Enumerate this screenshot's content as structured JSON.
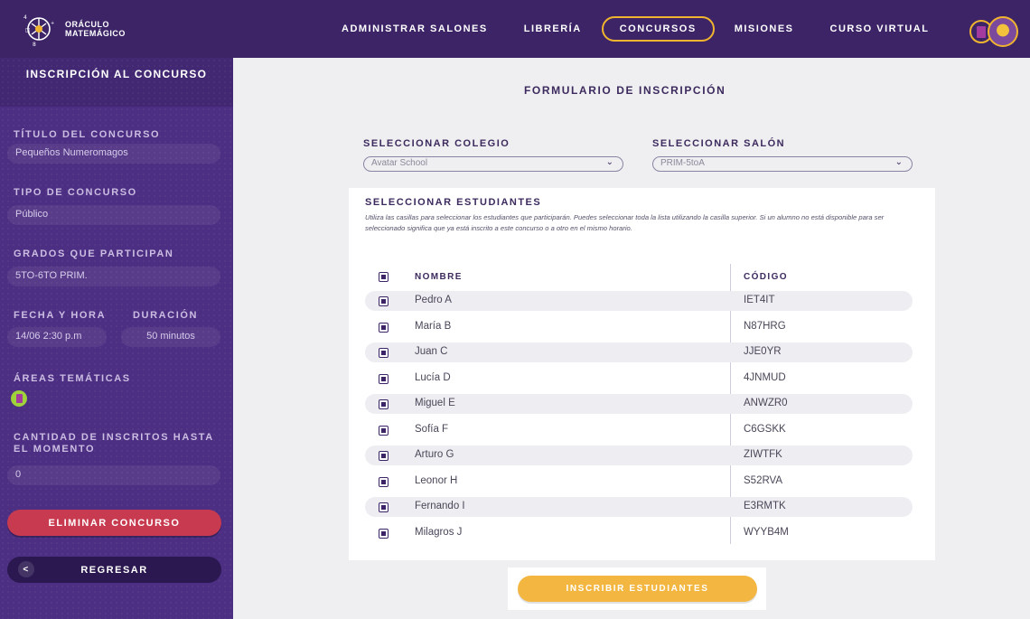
{
  "brand": {
    "line1": "ORÁCULO",
    "line2": "MATEMÁGICO"
  },
  "nav": {
    "items": [
      {
        "label": "ADMINISTRAR SALONES"
      },
      {
        "label": "LIBRERÍA"
      },
      {
        "label": "CONCURSOS"
      },
      {
        "label": "MISIONES"
      },
      {
        "label": "CURSO VIRTUAL"
      }
    ]
  },
  "sidebar": {
    "title": "INSCRIPCIÓN AL CONCURSO",
    "contest_title_label": "TÍTULO DEL CONCURSO",
    "contest_title_value": "Pequeños Numeromagos",
    "type_label": "TIPO DE CONCURSO",
    "type_value": "Público",
    "grades_label": "GRADOS QUE PARTICIPAN",
    "grades_value": "5TO-6TO PRIM.",
    "datetime_label": "FECHA Y HORA",
    "datetime_value": "14/06 2:30 p.m",
    "duration_label": "DURACIÓN",
    "duration_value": "50 minutos",
    "areas_label": "ÁREAS TEMÁTICAS",
    "count_label_1": "CANTIDAD DE INSCRITOS HASTA",
    "count_label_2": "EL MOMENTO",
    "count_value": "0",
    "delete_label": "ELIMINAR CONCURSO",
    "back_chevron": "<",
    "back_label": "REGRESAR"
  },
  "form": {
    "title": "FORMULARIO DE INSCRIPCIÓN",
    "school_label": "SELECCIONAR COLEGIO",
    "school_value": "Avatar School",
    "room_label": "SELECCIONAR SALÓN",
    "room_value": "PRIM-5toA",
    "arrow": "⌄"
  },
  "students": {
    "title": "SELECCIONAR ESTUDIANTES",
    "description": "Utiliza las casillas para seleccionar los estudiantes que participarán. Puedes seleccionar toda la lista utilizando la casilla superior. Si un alumno no está disponible para ser seleccionado significa que ya está inscrito a este concurso o a otro en el mismo horario.",
    "col_name": "NOMBRE",
    "col_code": "CÓDIGO",
    "rows": [
      {
        "name": "Pedro A",
        "code": "IET4IT"
      },
      {
        "name": "María B",
        "code": "N87HRG"
      },
      {
        "name": "Juan C",
        "code": "JJE0YR"
      },
      {
        "name": "Lucía D",
        "code": "4JNMUD"
      },
      {
        "name": "Miguel E",
        "code": "ANWZR0"
      },
      {
        "name": "Sofía F",
        "code": "C6GSKK"
      },
      {
        "name": "Arturo G",
        "code": "ZIWTFK"
      },
      {
        "name": "Leonor H",
        "code": "S52RVA"
      },
      {
        "name": "Fernando I",
        "code": "E3RMTK"
      },
      {
        "name": "Milagros J",
        "code": "WYYB4M"
      }
    ]
  },
  "submit_label": "INSCRIBIR ESTUDIANTES",
  "colors": {
    "primary": "#3c2467",
    "accent": "#f0b42e",
    "danger": "#c83a4f",
    "submit": "#f3b640"
  }
}
